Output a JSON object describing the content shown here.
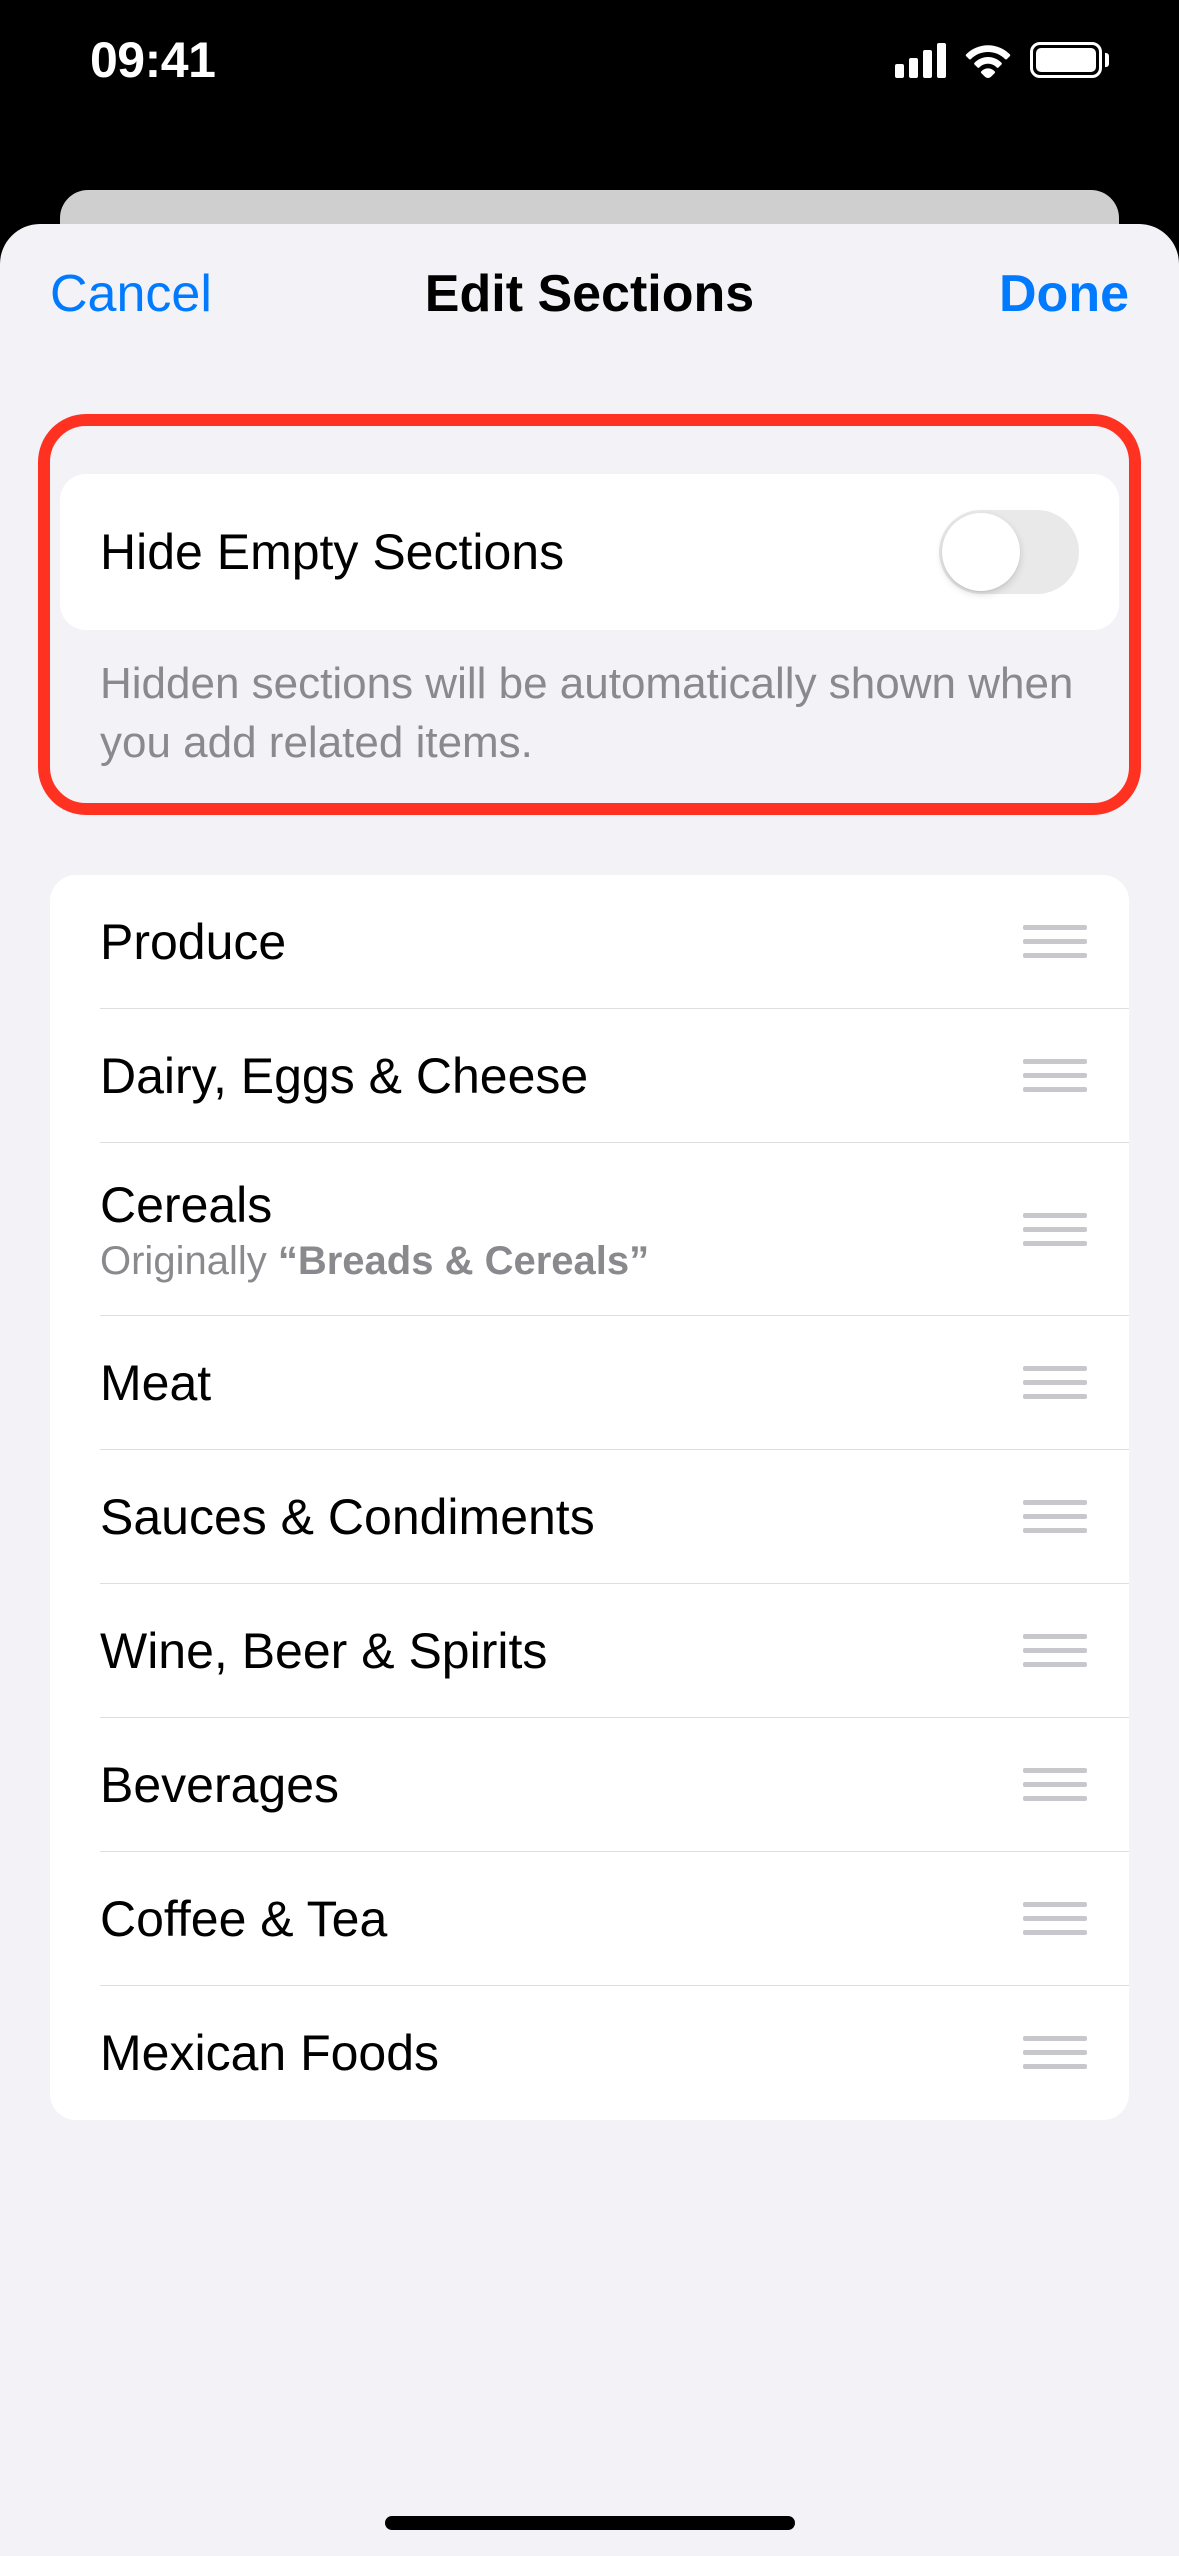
{
  "status": {
    "time": "09:41"
  },
  "nav": {
    "cancel": "Cancel",
    "title": "Edit Sections",
    "done": "Done"
  },
  "toggle": {
    "label": "Hide Empty Sections",
    "footer": "Hidden sections will be automatically shown when you add related items.",
    "on": false
  },
  "sections": [
    {
      "label": "Produce"
    },
    {
      "label": "Dairy, Eggs & Cheese"
    },
    {
      "label": "Cereals",
      "sub_prefix": "Originally ",
      "sub_quoted": "“Breads & Cereals”"
    },
    {
      "label": "Meat"
    },
    {
      "label": "Sauces & Condiments"
    },
    {
      "label": "Wine, Beer & Spirits"
    },
    {
      "label": "Beverages"
    },
    {
      "label": "Coffee & Tea"
    },
    {
      "label": "Mexican Foods"
    }
  ]
}
